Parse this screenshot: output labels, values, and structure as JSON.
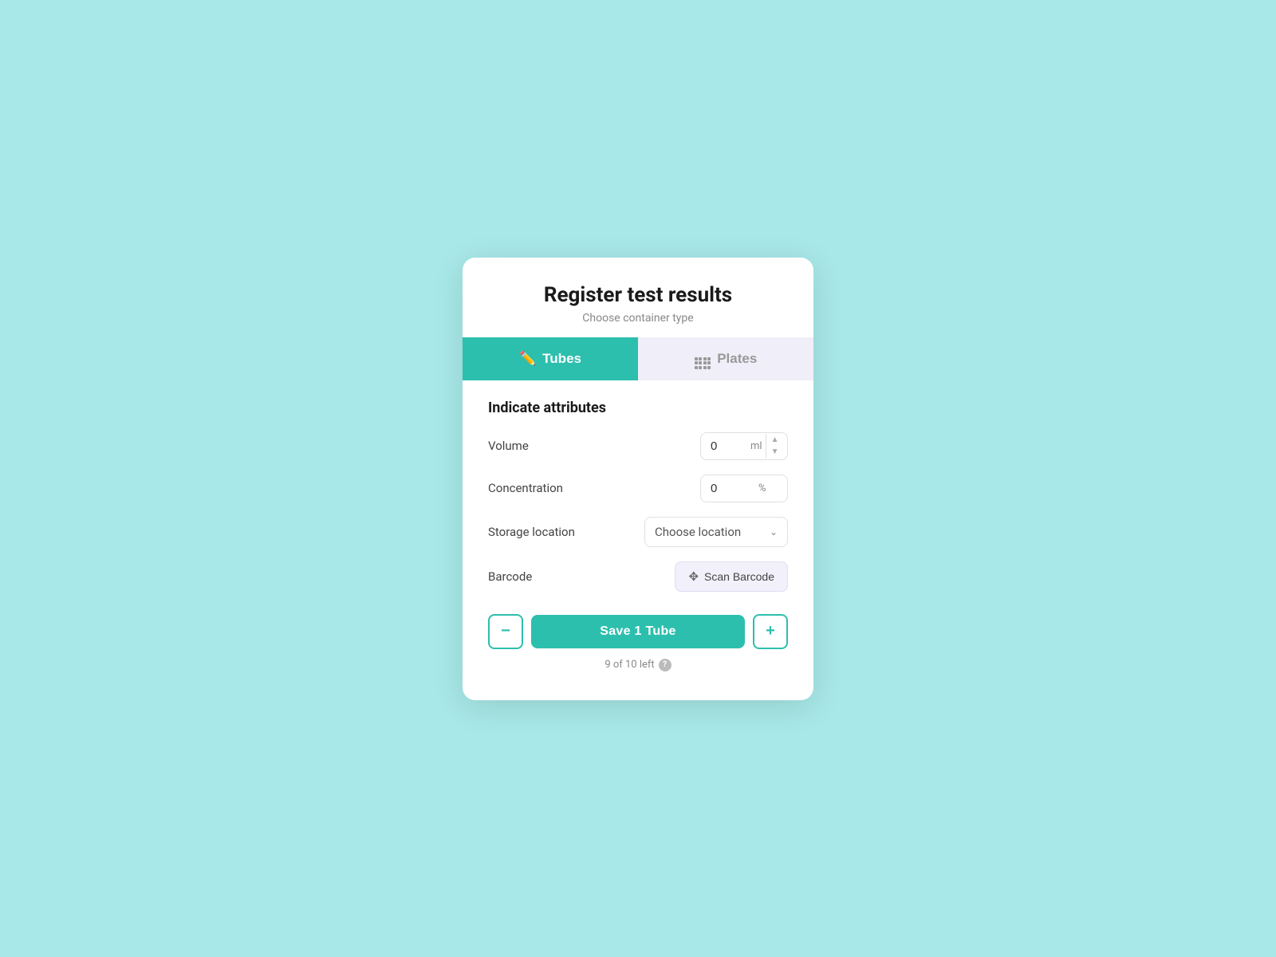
{
  "modal": {
    "title": "Register test results",
    "subtitle": "Choose container type"
  },
  "tabs": {
    "tubes": {
      "label": "Tubes",
      "active": true
    },
    "plates": {
      "label": "Plates",
      "active": false
    }
  },
  "form": {
    "section_title": "Indicate attributes",
    "fields": {
      "volume": {
        "label": "Volume",
        "value": "0",
        "unit": "ml"
      },
      "concentration": {
        "label": "Concentration",
        "value": "0",
        "unit": "%"
      },
      "storage_location": {
        "label": "Storage location",
        "placeholder": "Choose location"
      },
      "barcode": {
        "label": "Barcode",
        "button_label": "Scan Barcode"
      }
    }
  },
  "actions": {
    "save_label": "Save 1 Tube",
    "counter_text": "9 of 10 left"
  }
}
